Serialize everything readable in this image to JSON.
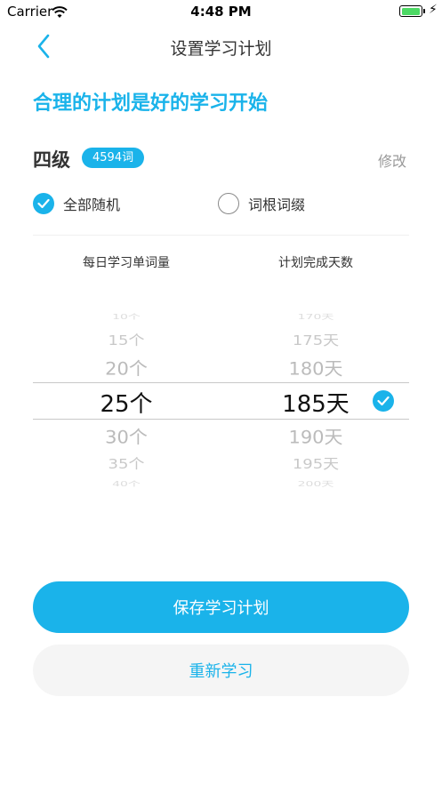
{
  "status_bar": {
    "carrier": "Carrier",
    "time": "4:48 PM",
    "battery_level": 1.0
  },
  "nav": {
    "title": "设置学习计划"
  },
  "headline": "合理的计划是好的学习开始",
  "plan": {
    "level": "四级",
    "word_count": "4594词",
    "edit_label": "修改"
  },
  "options": [
    {
      "label": "全部随机",
      "checked": true
    },
    {
      "label": "词根词缀",
      "checked": false
    }
  ],
  "picker": {
    "headers": {
      "daily": "每日学习单词量",
      "days": "计划完成天数"
    },
    "daily": [
      "10个",
      "15个",
      "20个",
      "25个",
      "30个",
      "35个",
      "40个"
    ],
    "days": [
      "170天",
      "175天",
      "180天",
      "185天",
      "190天",
      "195天",
      "200天"
    ],
    "selected_daily": "25个",
    "selected_days": "185天"
  },
  "buttons": {
    "save": "保存学习计划",
    "reset": "重新学习"
  },
  "colors": {
    "accent": "#1ab3ea",
    "secondary_bg": "#f5f5f5"
  }
}
